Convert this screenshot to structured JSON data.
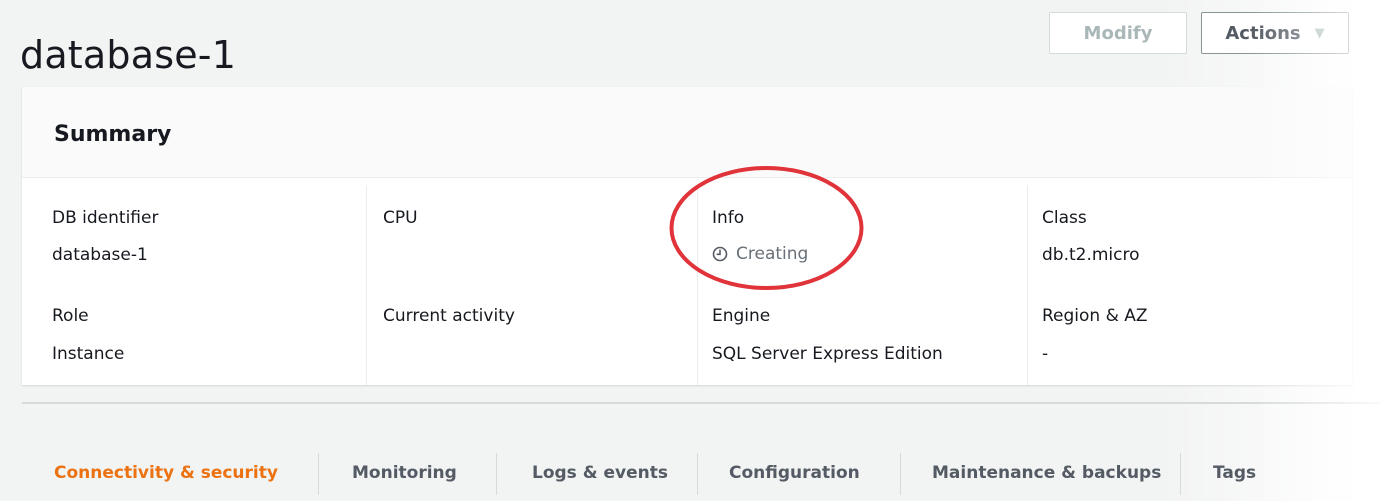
{
  "header": {
    "title": "database-1",
    "modify_label": "Modify",
    "actions_label": "Actions"
  },
  "summary": {
    "title": "Summary",
    "fields": {
      "db_identifier": {
        "label": "DB identifier",
        "value": "database-1"
      },
      "cpu": {
        "label": "CPU",
        "value": ""
      },
      "info": {
        "label": "Info",
        "value": "Creating"
      },
      "class": {
        "label": "Class",
        "value": "db.t2.micro"
      },
      "role": {
        "label": "Role",
        "value": "Instance"
      },
      "current_activity": {
        "label": "Current activity",
        "value": ""
      },
      "engine": {
        "label": "Engine",
        "value": "SQL Server Express Edition"
      },
      "region_az": {
        "label": "Region & AZ",
        "value": "-"
      }
    }
  },
  "tabs": [
    {
      "label": "Connectivity & security",
      "active": true
    },
    {
      "label": "Monitoring",
      "active": false
    },
    {
      "label": "Logs & events",
      "active": false
    },
    {
      "label": "Configuration",
      "active": false
    },
    {
      "label": "Maintenance & backups",
      "active": false
    },
    {
      "label": "Tags",
      "active": false
    }
  ],
  "colors": {
    "accent_tab": "#ec7211",
    "highlight_ring": "#e0333a",
    "status_text": "#687078"
  },
  "icons": {
    "status": "clock-icon",
    "actions_caret": "caret-down-icon"
  }
}
